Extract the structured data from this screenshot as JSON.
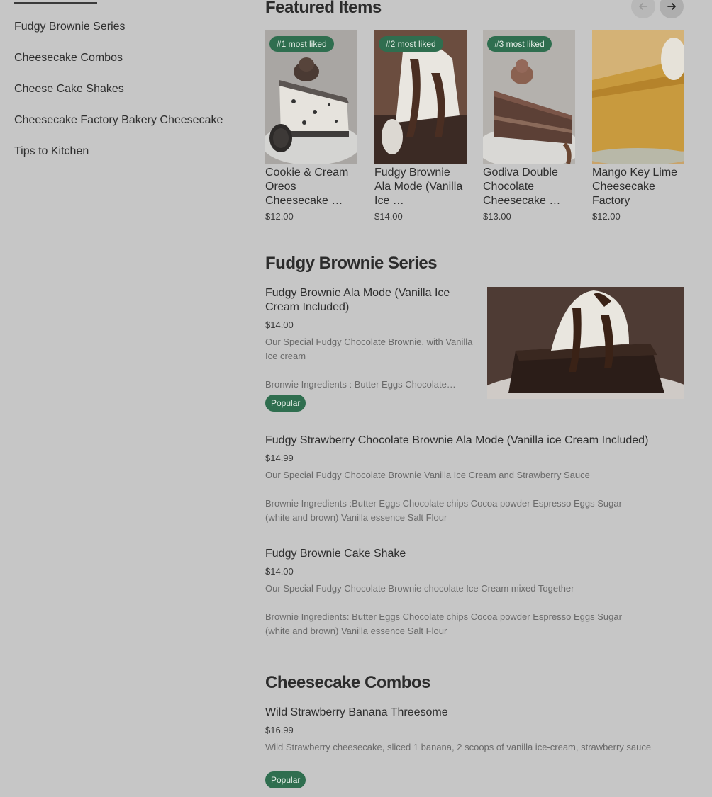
{
  "sidebar": {
    "items": [
      {
        "label": "Fudgy Brownie Series"
      },
      {
        "label": "Cheesecake Combos"
      },
      {
        "label": "Cheese Cake Shakes"
      },
      {
        "label": "Cheesecake Factory Bakery Cheesecake"
      },
      {
        "label": "Tips to Kitchen"
      }
    ]
  },
  "featured": {
    "title": "Featured Items",
    "prev_icon": "arrow-left-icon",
    "next_icon": "arrow-right-icon",
    "cards": [
      {
        "badge": "#1 most liked",
        "name": "Cookie & Cream Oreos Cheesecake …",
        "price": "$12.00"
      },
      {
        "badge": "#2 most liked",
        "name": "Fudgy Brownie Ala Mode (Vanilla Ice …",
        "price": "$14.00"
      },
      {
        "badge": "#3 most liked",
        "name": "Godiva Double Chocolate Cheesecake …",
        "price": "$13.00"
      },
      {
        "badge": "",
        "name": "Mango Key Lime Cheesecake Factory",
        "price": "$12.00"
      }
    ]
  },
  "fudgy": {
    "title": "Fudgy Brownie Series",
    "items": [
      {
        "name": "Fudgy Brownie Ala Mode (Vanilla Ice Cream Included)",
        "price": "$14.00",
        "desc": "Our Special Fudgy Chocolate Brownie, with Vanilla Ice cream",
        "ingredients": "Bronwie Ingredients : Butter Eggs Chocolate…",
        "tag": "Popular"
      },
      {
        "name": "Fudgy Strawberry Chocolate Brownie Ala Mode (Vanilla ice Cream Included)",
        "price": "$14.99",
        "desc": "Our Special Fudgy Chocolate Brownie Vanilla Ice Cream and Strawberry Sauce",
        "ingredients": "Brownie Ingredients :Butter Eggs Chocolate chips Cocoa powder Espresso Eggs Sugar (white and brown) Vanilla essence Salt Flour"
      },
      {
        "name": "Fudgy Brownie Cake Shake",
        "price": "$14.00",
        "desc": "Our Special Fudgy Chocolate Brownie chocolate Ice Cream mixed Together",
        "ingredients": "Brownie Ingredients: Butter Eggs Chocolate chips Cocoa powder Espresso Eggs Sugar (white and brown) Vanilla essence Salt Flour"
      }
    ]
  },
  "combos": {
    "title": "Cheesecake Combos",
    "items": [
      {
        "name": "Wild Strawberry Banana Threesome",
        "price": "$16.99",
        "desc": "Wild Strawberry cheesecake, sliced 1 banana, 2 scoops of vanilla ice-cream, strawberry sauce",
        "tag": "Popular"
      }
    ]
  },
  "colors": {
    "background": "#c6c6c6",
    "badge_green": "#2f6e4f"
  }
}
